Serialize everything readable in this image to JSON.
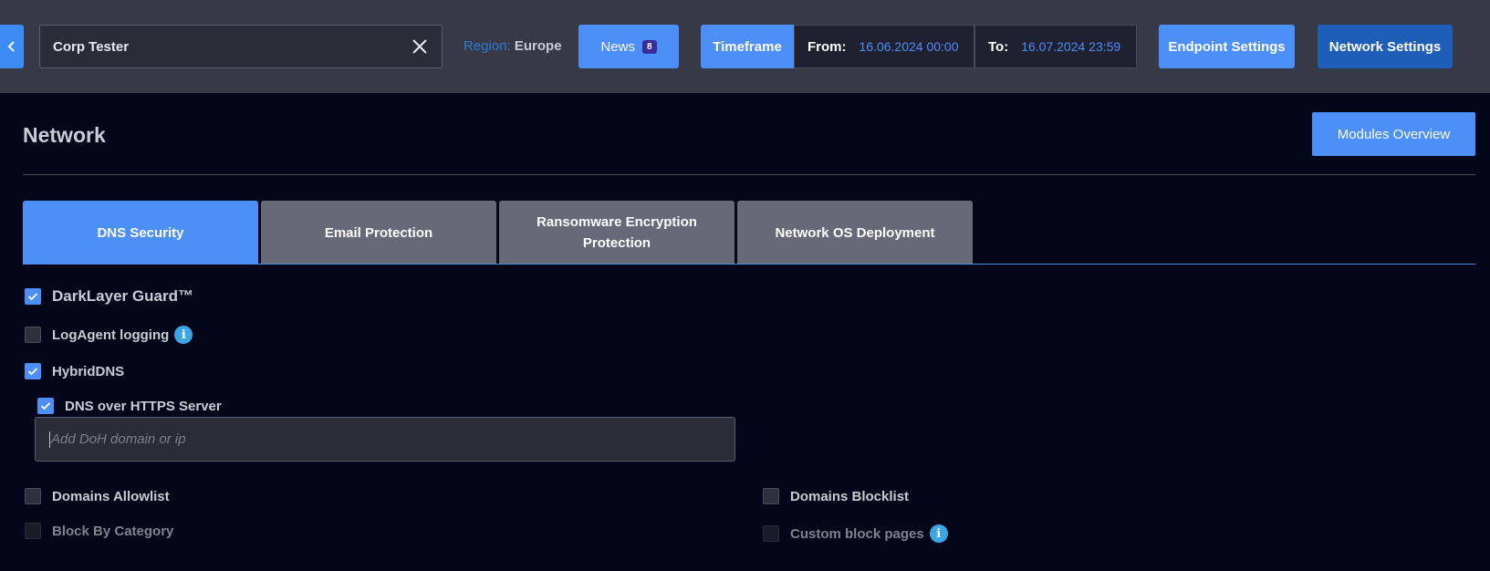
{
  "topbar": {
    "search": {
      "value": "Corp Tester"
    },
    "region": {
      "label": "Region:",
      "value": "Europe"
    },
    "news": {
      "label": "News",
      "badge": "8"
    },
    "timeframe": {
      "label": "Timeframe",
      "from_label": "From:",
      "from_value": "16.06.2024 00:00",
      "to_label": "To:",
      "to_value": "16.07.2024 23:59"
    },
    "endpoint_settings": "Endpoint Settings",
    "network_settings": "Network Settings"
  },
  "page": {
    "title": "Network",
    "modules_overview": "Modules Overview"
  },
  "tabs": [
    {
      "label": "DNS Security",
      "active": true
    },
    {
      "label": "Email Protection",
      "active": false
    },
    {
      "label": "Ransomware Encryption Protection",
      "active": false
    },
    {
      "label": "Network OS Deployment",
      "active": false
    }
  ],
  "options": {
    "darklayer": {
      "label": "DarkLayer Guard™",
      "checked": true
    },
    "logagent": {
      "label": "LogAgent logging",
      "checked": false
    },
    "hybriddns": {
      "label": "HybridDNS",
      "checked": true
    },
    "doh_server": {
      "label": "DNS over HTTPS Server",
      "checked": true
    },
    "doh_input": {
      "placeholder": "Add DoH domain or ip"
    },
    "allowlist": {
      "label": "Domains Allowlist",
      "checked": false
    },
    "blocklist": {
      "label": "Domains Blocklist",
      "checked": false
    },
    "block_category": {
      "label": "Block By Category",
      "checked": false,
      "disabled": true
    },
    "custom_block": {
      "label": "Custom block pages",
      "checked": false,
      "disabled": true
    }
  },
  "colors": {
    "accent": "#4b8ff7",
    "topbar": "#383946",
    "background": "#04061a",
    "info": "#3aa6e4"
  }
}
